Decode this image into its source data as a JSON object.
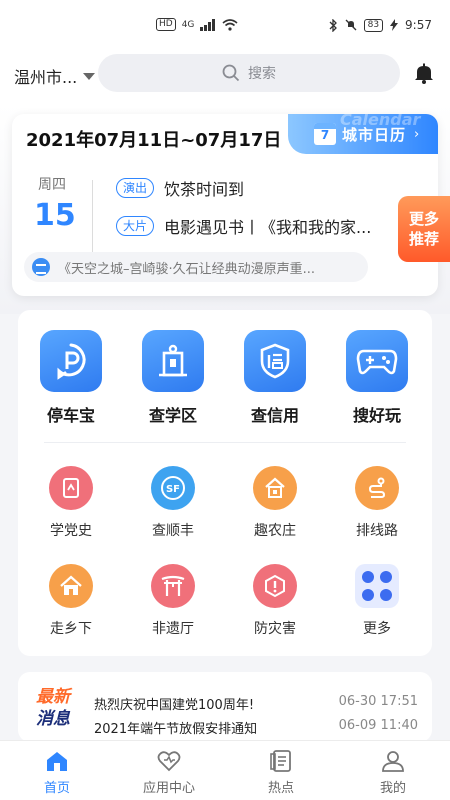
{
  "statusbar": {
    "hd": "HD",
    "net": "4G",
    "battery": "83",
    "time": "9:57"
  },
  "topbar": {
    "city": "温州市...",
    "search_placeholder": "搜索"
  },
  "calendar": {
    "date_range": "2021年07月11日~07月17日",
    "tag_label": "城市日历",
    "tag_watermark": "Calendar",
    "tag_day": "7",
    "weekday": "周四",
    "day": "15",
    "events": [
      {
        "badge": "演出",
        "title": "饮茶时间到"
      },
      {
        "badge": "大片",
        "title": "电影遇见书丨《我和我的家..."
      }
    ],
    "news_snippet": "《天空之城–宫崎骏·久石让经典动漫原声重..."
  },
  "more_tab": {
    "line1": "更多",
    "line2": "推荐"
  },
  "services": {
    "primary": [
      {
        "label": "停车宝",
        "icon": "parking-icon"
      },
      {
        "label": "查学区",
        "icon": "school-icon"
      },
      {
        "label": "查信用",
        "icon": "credit-shield-icon"
      },
      {
        "label": "搜好玩",
        "icon": "gamepad-icon"
      }
    ],
    "secondary": [
      {
        "label": "学党史",
        "icon": "book-icon",
        "color": "#f0707a"
      },
      {
        "label": "查顺丰",
        "icon": "sf-express-icon",
        "color": "#3ea3f0"
      },
      {
        "label": "趣农庄",
        "icon": "farm-house-icon",
        "color": "#f7a04a"
      },
      {
        "label": "排线路",
        "icon": "route-icon",
        "color": "#f7a04a"
      },
      {
        "label": "走乡下",
        "icon": "village-icon",
        "color": "#f7a04a"
      },
      {
        "label": "非遗厅",
        "icon": "gate-icon",
        "color": "#f0707a"
      },
      {
        "label": "防灾害",
        "icon": "alert-icon",
        "color": "#f0707a"
      },
      {
        "label": "更多",
        "icon": "more-grid-icon",
        "color": "#3c6cf0"
      }
    ]
  },
  "news": {
    "logo_line1": "最新",
    "logo_line2": "消息",
    "items": [
      {
        "title": "热烈庆祝中国建党100周年!",
        "time": "06-30 17:51"
      },
      {
        "title": "2021年端午节放假安排通知",
        "time": "06-09 11:40"
      }
    ]
  },
  "tabbar": {
    "items": [
      {
        "label": "首页",
        "icon": "home-icon",
        "active": true
      },
      {
        "label": "应用中心",
        "icon": "heart-icon",
        "active": false
      },
      {
        "label": "热点",
        "icon": "document-icon",
        "active": false
      },
      {
        "label": "我的",
        "icon": "profile-icon",
        "active": false
      }
    ]
  }
}
